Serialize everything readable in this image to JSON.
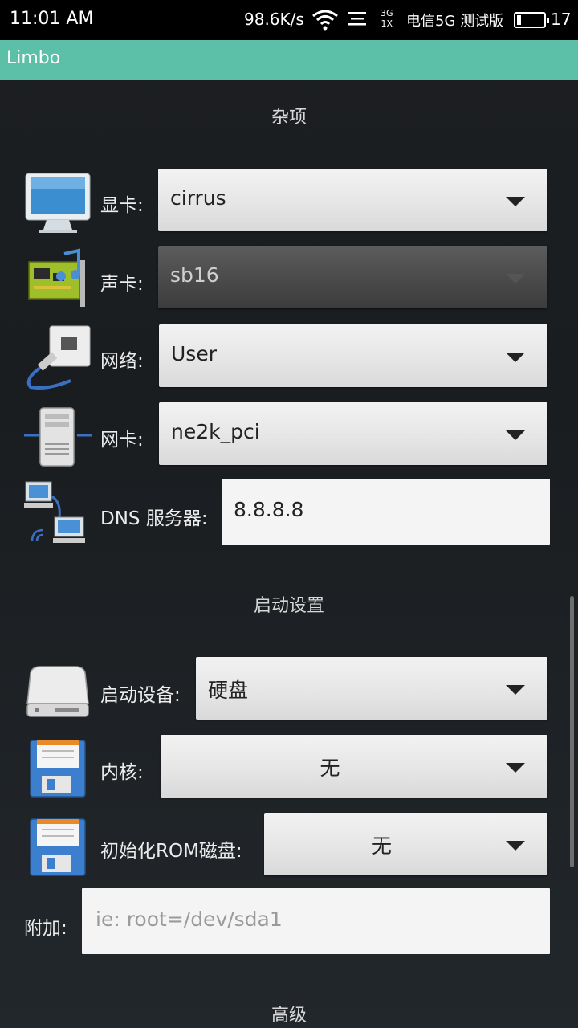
{
  "status": {
    "time": "11:01 AM",
    "speed": "98.6K/s",
    "net_top": "3G",
    "net_bottom": "1X",
    "carrier": "电信5G 测试版",
    "battery_level": "17",
    "battery_fraction": 0.17
  },
  "app": {
    "title": "Limbo"
  },
  "misc": {
    "title": "杂项",
    "display": {
      "label": "显卡:",
      "value": "cirrus"
    },
    "sound": {
      "label": "声卡:",
      "value": "sb16"
    },
    "network": {
      "label": "网络:",
      "value": "User"
    },
    "nic": {
      "label": "网卡:",
      "value": "ne2k_pci"
    },
    "dns": {
      "label": "DNS 服务器:",
      "value": "8.8.8.8"
    }
  },
  "boot": {
    "title": "启动设置",
    "boot_device": {
      "label": "启动设备:",
      "value": "硬盘"
    },
    "kernel": {
      "label": "内核:",
      "value": "无"
    },
    "initrd": {
      "label": "初始化ROM磁盘:",
      "value": "无"
    },
    "append": {
      "label": "附加:",
      "placeholder": "ie: root=/dev/sda1"
    }
  },
  "advanced": {
    "title": "高级"
  }
}
